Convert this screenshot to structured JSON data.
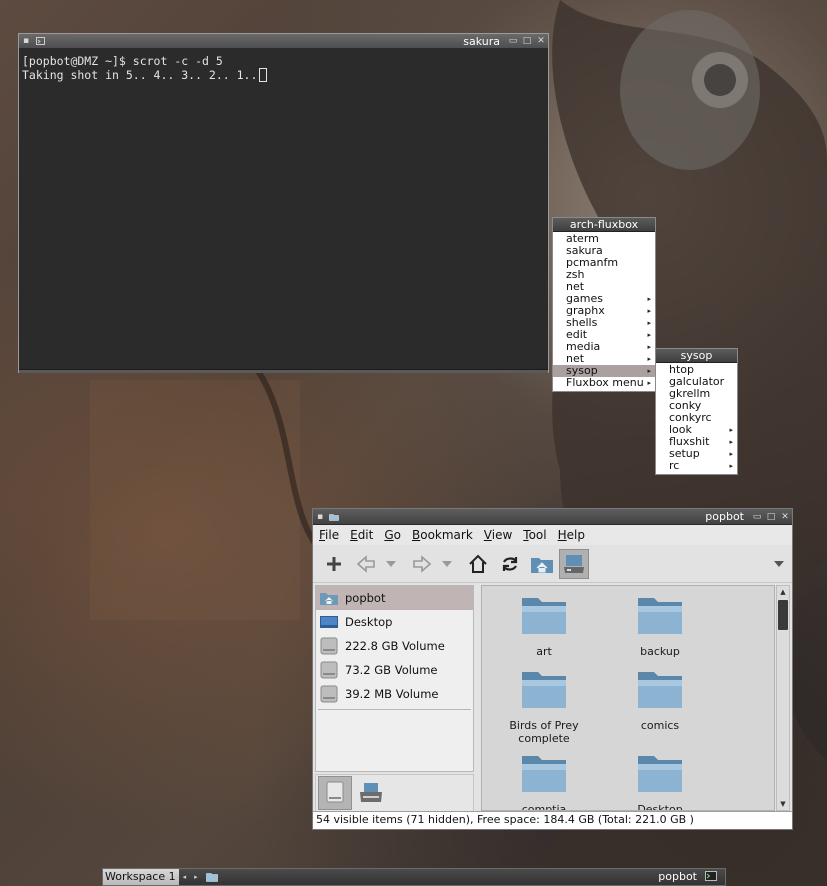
{
  "terminal": {
    "title": "sakura",
    "lines": [
      "[popbot@DMZ ~]$ scrot -c -d 5",
      "Taking shot in 5.. 4.. 3.. 2.. 1.."
    ]
  },
  "root_menu": {
    "title": "arch-fluxbox",
    "items": [
      {
        "label": "aterm",
        "submenu": false
      },
      {
        "label": "sakura",
        "submenu": false
      },
      {
        "label": "pcmanfm",
        "submenu": false
      },
      {
        "label": "zsh",
        "submenu": false
      },
      {
        "label": "net",
        "submenu": false
      },
      {
        "label": "games",
        "submenu": true
      },
      {
        "label": "graphx",
        "submenu": true
      },
      {
        "label": "shells",
        "submenu": true
      },
      {
        "label": "edit",
        "submenu": true
      },
      {
        "label": "media",
        "submenu": true
      },
      {
        "label": "net",
        "submenu": true
      },
      {
        "label": "sysop",
        "submenu": true,
        "active": true
      },
      {
        "label": "Fluxbox menu",
        "submenu": true
      }
    ]
  },
  "sysop_menu": {
    "title": "sysop",
    "items": [
      {
        "label": "htop",
        "submenu": false
      },
      {
        "label": "galculator",
        "submenu": false
      },
      {
        "label": "gkrellm",
        "submenu": false
      },
      {
        "label": "conky",
        "submenu": false
      },
      {
        "label": "conkyrc",
        "submenu": false
      },
      {
        "label": "look",
        "submenu": true
      },
      {
        "label": "fluxshit",
        "submenu": true
      },
      {
        "label": "setup",
        "submenu": true
      },
      {
        "label": "rc",
        "submenu": true
      }
    ]
  },
  "filemanager": {
    "title": "popbot",
    "menu": [
      {
        "mnemonic": "F",
        "rest": "ile"
      },
      {
        "mnemonic": "E",
        "rest": "dit"
      },
      {
        "mnemonic": "G",
        "rest": "o"
      },
      {
        "mnemonic": "B",
        "rest": "ookmark"
      },
      {
        "mnemonic": "V",
        "rest": "iew"
      },
      {
        "mnemonic": "T",
        "rest": "ool"
      },
      {
        "mnemonic": "H",
        "rest": "elp"
      }
    ],
    "places": [
      {
        "label": "popbot",
        "icon": "home-folder-icon",
        "active": true
      },
      {
        "label": "Desktop",
        "icon": "desktop-icon",
        "active": false
      },
      {
        "label": "222.8 GB Volume",
        "icon": "drive-icon",
        "active": false
      },
      {
        "label": "73.2 GB Volume",
        "icon": "drive-icon",
        "active": false
      },
      {
        "label": "39.2 MB Volume",
        "icon": "drive-icon",
        "active": false
      }
    ],
    "files": [
      {
        "name": "art"
      },
      {
        "name": "backup"
      },
      {
        "name": "Birds of Prey complete"
      },
      {
        "name": "comics"
      },
      {
        "name": "comptia"
      },
      {
        "name": "Desktop"
      }
    ],
    "status": "54 visible items (71 hidden), Free space: 184.4 GB (Total: 221.0 GB )"
  },
  "taskbar": {
    "workspace": "Workspace 1",
    "task_title": "popbot"
  },
  "colors": {
    "title_bg": "#4e4e4e",
    "menu_highlight": "#aaa0a0",
    "folder_blue": "#6e9ab8"
  }
}
